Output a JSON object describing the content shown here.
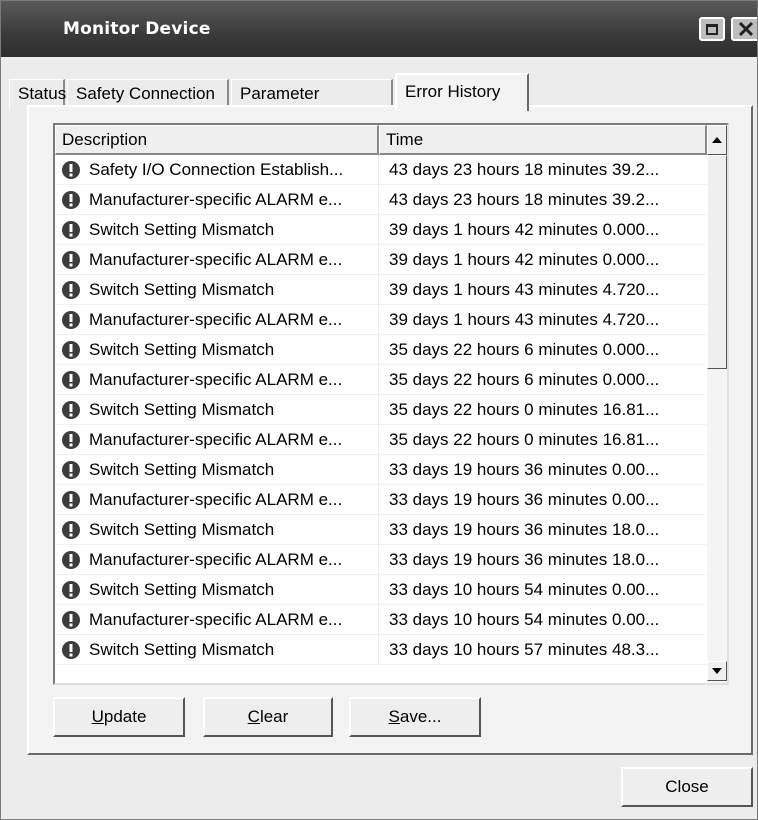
{
  "window": {
    "title": "Monitor Device"
  },
  "titlebar_buttons": {
    "maximize_icon": "maximize-icon",
    "close_icon": "close-icon"
  },
  "tabs": [
    {
      "label": "Status"
    },
    {
      "label": "Safety Connection"
    },
    {
      "label": "Parameter"
    },
    {
      "label": "Error History"
    }
  ],
  "active_tab": "Error History",
  "table": {
    "columns": [
      "Description",
      "Time"
    ],
    "rows": [
      {
        "description": "Safety I/O Connection Establish...",
        "time": "43 days 23 hours 18 minutes 39.2..."
      },
      {
        "description": "Manufacturer-specific ALARM e...",
        "time": "43 days 23 hours 18 minutes 39.2..."
      },
      {
        "description": "Switch Setting Mismatch",
        "time": "39 days 1 hours 42 minutes 0.000..."
      },
      {
        "description": "Manufacturer-specific ALARM e...",
        "time": "39 days 1 hours 42 minutes 0.000..."
      },
      {
        "description": "Switch Setting Mismatch",
        "time": "39 days 1 hours 43 minutes 4.720..."
      },
      {
        "description": "Manufacturer-specific ALARM e...",
        "time": "39 days 1 hours 43 minutes 4.720..."
      },
      {
        "description": "Switch Setting Mismatch",
        "time": "35 days 22 hours 6 minutes 0.000..."
      },
      {
        "description": "Manufacturer-specific ALARM e...",
        "time": "35 days 22 hours 6 minutes 0.000..."
      },
      {
        "description": "Switch Setting Mismatch",
        "time": "35 days 22 hours 0 minutes 16.81..."
      },
      {
        "description": "Manufacturer-specific ALARM e...",
        "time": "35 days 22 hours 0 minutes 16.81..."
      },
      {
        "description": "Switch Setting Mismatch",
        "time": "33 days 19 hours 36 minutes 0.00..."
      },
      {
        "description": "Manufacturer-specific ALARM e...",
        "time": "33 days 19 hours 36 minutes 0.00..."
      },
      {
        "description": "Switch Setting Mismatch",
        "time": "33 days 19 hours 36 minutes 18.0..."
      },
      {
        "description": "Manufacturer-specific ALARM e...",
        "time": "33 days 19 hours 36 minutes 18.0..."
      },
      {
        "description": "Switch Setting Mismatch",
        "time": "33 days 10 hours 54 minutes 0.00..."
      },
      {
        "description": "Manufacturer-specific ALARM e...",
        "time": "33 days 10 hours 54 minutes 0.00..."
      },
      {
        "description": "Switch Setting Mismatch",
        "time": "33 days 10 hours 57 minutes 48.3..."
      }
    ],
    "row_icon": "error-icon"
  },
  "buttons": {
    "update": {
      "mnemonic": "U",
      "rest": "pdate"
    },
    "clear": {
      "mnemonic": "C",
      "rest": "lear"
    },
    "save": {
      "mnemonic": "S",
      "rest": "ave..."
    },
    "close": "Close"
  },
  "colors": {
    "titlebar": "#3a3a3a",
    "dialog_bg": "#ececec",
    "list_bg": "#ffffff"
  }
}
